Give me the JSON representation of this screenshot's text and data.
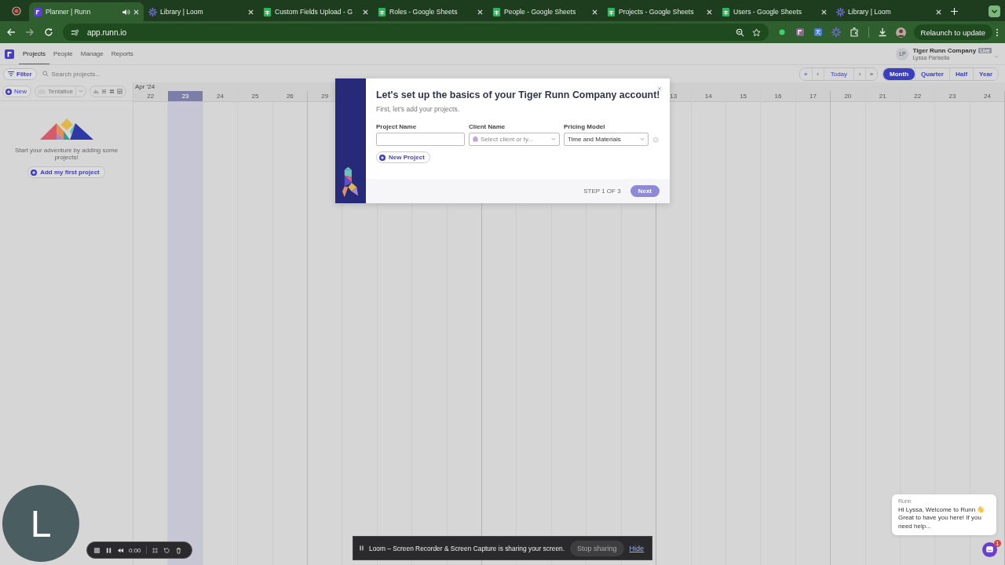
{
  "browser": {
    "tabs": [
      {
        "title": "Planner | Runn",
        "kind": "runn",
        "selected": true,
        "audio": true
      },
      {
        "title": "Library | Loom",
        "kind": "loom",
        "selected": false,
        "audio": false
      },
      {
        "title": "Custom Fields Upload - G",
        "kind": "sheets",
        "selected": false,
        "audio": false
      },
      {
        "title": "Roles - Google Sheets",
        "kind": "sheets",
        "selected": false,
        "audio": false
      },
      {
        "title": "People - Google Sheets",
        "kind": "sheets",
        "selected": false,
        "audio": false
      },
      {
        "title": "Projects - Google Sheets",
        "kind": "sheets",
        "selected": false,
        "audio": false
      },
      {
        "title": "Users - Google Sheets",
        "kind": "sheets",
        "selected": false,
        "audio": false
      },
      {
        "title": "Library | Loom",
        "kind": "loom",
        "selected": false,
        "audio": false
      }
    ],
    "url": "app.runn.io",
    "relaunch": "Relaunch to update"
  },
  "app": {
    "nav": [
      {
        "label": "Projects",
        "selected": true
      },
      {
        "label": "People",
        "selected": false
      },
      {
        "label": "Manage",
        "selected": false
      },
      {
        "label": "Reports",
        "selected": false
      }
    ],
    "account": {
      "initials": "LP",
      "company": "Tiger Runn Company",
      "badge": "Live",
      "user": "Lyssa Parisella"
    },
    "filter": "Filter",
    "search": {
      "placeholder": "Search projects..."
    },
    "date_nav": [
      "«",
      "‹",
      "Today",
      "›",
      "»"
    ],
    "views": [
      {
        "label": "Month",
        "selected": true
      },
      {
        "label": "Quarter",
        "selected": false
      },
      {
        "label": "Half",
        "selected": false
      },
      {
        "label": "Year",
        "selected": false
      }
    ],
    "new_button": "New",
    "tentative": "Tentative",
    "timeline": {
      "month": "Apr '24",
      "days_left": [
        {
          "label": "22",
          "today": false
        },
        {
          "label": "23",
          "today": true
        },
        {
          "label": "24",
          "today": false
        },
        {
          "label": "25",
          "today": false
        },
        {
          "label": "26",
          "today": false
        },
        {
          "label": "29",
          "today": false
        }
      ],
      "days_right": [
        {
          "label": "13",
          "today": false
        },
        {
          "label": "14",
          "today": false
        },
        {
          "label": "15",
          "today": false
        },
        {
          "label": "16",
          "today": false
        },
        {
          "label": "17",
          "today": false
        },
        {
          "label": "20",
          "today": false
        },
        {
          "label": "21",
          "today": false
        },
        {
          "label": "22",
          "today": false
        },
        {
          "label": "23",
          "today": false
        },
        {
          "label": "24",
          "today": false
        }
      ]
    },
    "empty_state": {
      "message": "Start your adventure by adding some projects!",
      "button": "Add my first project"
    }
  },
  "dialog": {
    "title": "Let's set up the basics of your Tiger Runn Company account!",
    "subtitle": "First, let's add your projects.",
    "fields": [
      {
        "label": "Project Name",
        "kind": "text"
      },
      {
        "label": "Client Name",
        "kind": "select",
        "placeholder": "Select client or ty..."
      },
      {
        "label": "Pricing Model",
        "kind": "select",
        "value": "Time and Materials"
      }
    ],
    "add_button": "New Project",
    "step": "STEP 1 OF 3",
    "next": {
      "label": "Next",
      "disabled": true
    }
  },
  "recorder": {
    "avatar": "L",
    "time": "0:00"
  },
  "share_bar": {
    "message": "Loom – Screen Recorder & Screen Capture is sharing your screen.",
    "stop": "Stop sharing",
    "hide": "Hide"
  },
  "chat": {
    "sender": "Runn",
    "message": "Hi Lyssa, Welcome to Runn 👋 Great to have you here! If you need help...",
    "badge": "1"
  }
}
